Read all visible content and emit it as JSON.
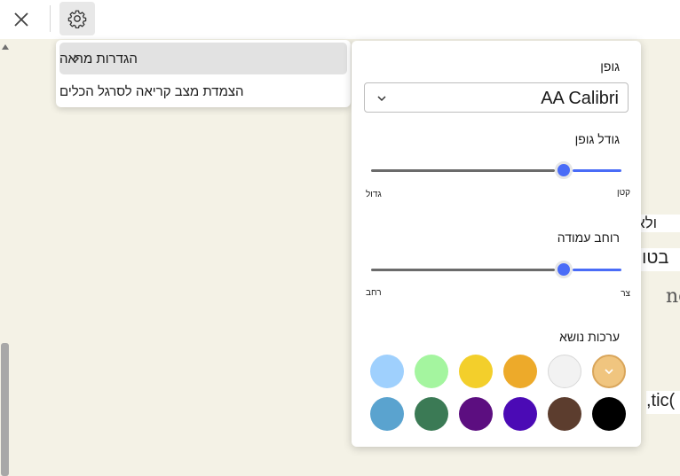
{
  "menu": {
    "items": [
      {
        "label": "הגדרות מראה"
      },
      {
        "label": "הצמדת מצב קריאה לסרגל הכלים"
      }
    ]
  },
  "panel": {
    "font_label": "גופן",
    "font_value": "AA Calibri",
    "font_size_label": "גודל גופן",
    "font_size_min": "קטן",
    "font_size_max": "גדול",
    "font_size_value": 0.77,
    "column_width_label": "רוחב עמודה",
    "column_width_min": "צר",
    "column_width_max": "רחב",
    "column_width_value": 0.77,
    "theme_label": "ערכות נושא",
    "themes_row1": [
      "#f0c57f",
      "#f2f2f2",
      "#edaa2a",
      "#f3cf2b",
      "#a4f59f",
      "#9fd0fd"
    ],
    "themes_row2": [
      "#000000",
      "#5c3d2e",
      "#4b0ab5",
      "#5c0e80",
      "#3b7a55",
      "#5aa3cf"
    ],
    "selected_theme_index": 0
  },
  "background": {
    "snippet1": "ולא",
    "snippet2": "בטוח",
    "snippet3": "ne i",
    "snippet4": ",tic("
  },
  "colors": {
    "accent": "#4a6cf7",
    "page_bg": "#f4f2e6"
  }
}
